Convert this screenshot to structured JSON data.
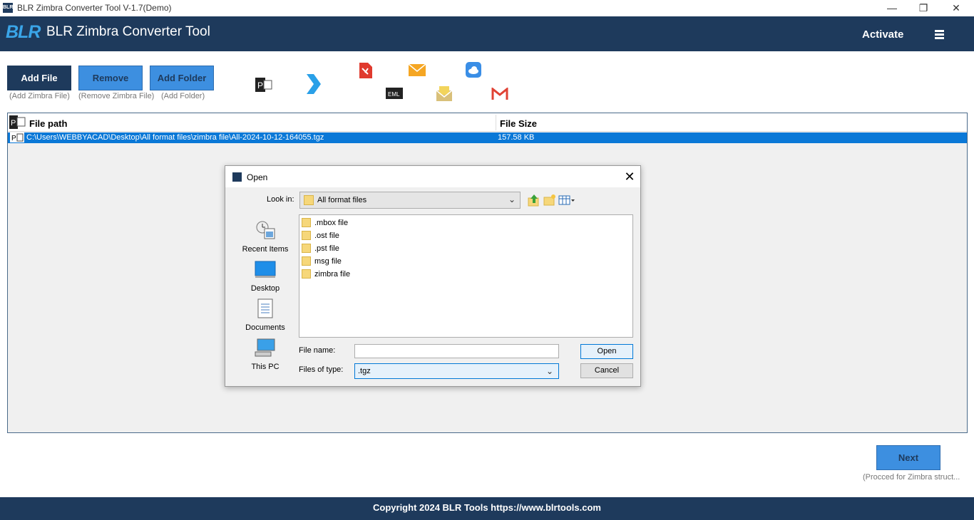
{
  "window": {
    "title": "BLR Zimbra Converter Tool V-1.7(Demo)",
    "minimize": "—",
    "restore": "❐",
    "close": "✕"
  },
  "header": {
    "logo": "BLR",
    "title": "BLR Zimbra Converter Tool",
    "activate": "Activate"
  },
  "toolbar": {
    "add_file": "Add File",
    "add_file_caption": "(Add Zimbra File)",
    "remove": "Remove",
    "remove_caption": "(Remove Zimbra File)",
    "add_folder": "Add Folder",
    "add_folder_caption": "(Add Folder)",
    "eml_label": "EML"
  },
  "table": {
    "columns": [
      "File path",
      "File Size"
    ],
    "rows": [
      {
        "path": "C:\\Users\\WEBBYACAD\\Desktop\\All format files\\zimbra file\\All-2024-10-12-164055.tgz",
        "size": "157.58 KB"
      }
    ]
  },
  "next": {
    "label": "Next",
    "caption": "(Procced for Zimbra struct..."
  },
  "footer": {
    "text": "Copyright 2024 BLR Tools https://www.blrtools.com"
  },
  "dialog": {
    "title": "Open",
    "look_in_label": "Look in:",
    "look_in_value": "All format files",
    "places": [
      "Recent Items",
      "Desktop",
      "Documents",
      "This PC"
    ],
    "files": [
      ".mbox file",
      ".ost file",
      ".pst file",
      "msg file",
      "zimbra file"
    ],
    "file_name_label": "File name:",
    "file_name_value": "",
    "files_of_type_label": "Files of type:",
    "files_of_type_value": ".tgz",
    "open_button": "Open",
    "cancel_button": "Cancel"
  }
}
